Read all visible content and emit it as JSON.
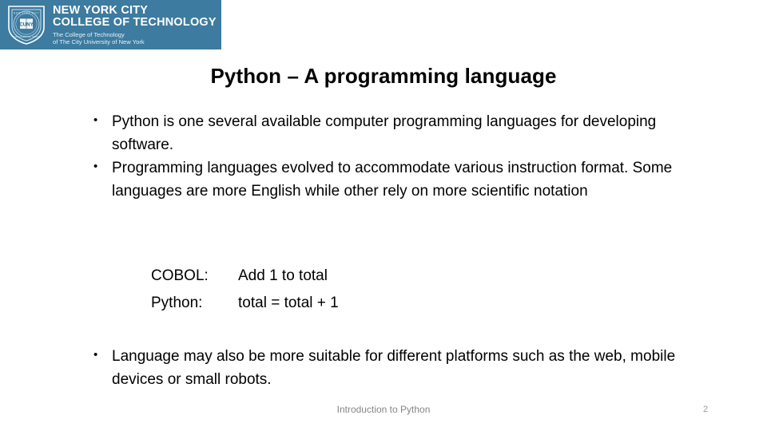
{
  "header": {
    "logo": {
      "icon": "cuny-shield-seal-icon",
      "seal_center_text": "CUNY",
      "seal_ring_top_text": "NEW YORK CITY",
      "seal_ring_bottom_text": "COLLEGE OF TECHNOLOGY"
    },
    "institution_line_1": "NEW YORK CITY",
    "institution_line_2": "COLLEGE OF TECHNOLOGY",
    "tagline_line_1": "The College of Technology",
    "tagline_line_2": "of The City University of New York",
    "banner_color": "#3d7ba0",
    "banner_text_color": "#ffffff"
  },
  "slide": {
    "title": "Python – A programming language",
    "bullets_top": [
      {
        "marker": "•",
        "text": "Python is one several available computer programming languages for developing software."
      },
      {
        "marker": "•",
        "text": "Programming languages evolved to accommodate various instruction format. Some languages are more English while other rely on more scientific notation"
      }
    ],
    "code_examples": [
      {
        "label": "COBOL:",
        "code": "Add 1 to total"
      },
      {
        "label": "Python:",
        "code": "total = total + 1"
      }
    ],
    "bullets_bottom": [
      {
        "marker": "•",
        "text": "Language may also be more suitable for different platforms such as the web, mobile devices or small robots."
      }
    ]
  },
  "footer": {
    "note": "Introduction to Python",
    "page_number": "2",
    "text_color": "#868686"
  }
}
